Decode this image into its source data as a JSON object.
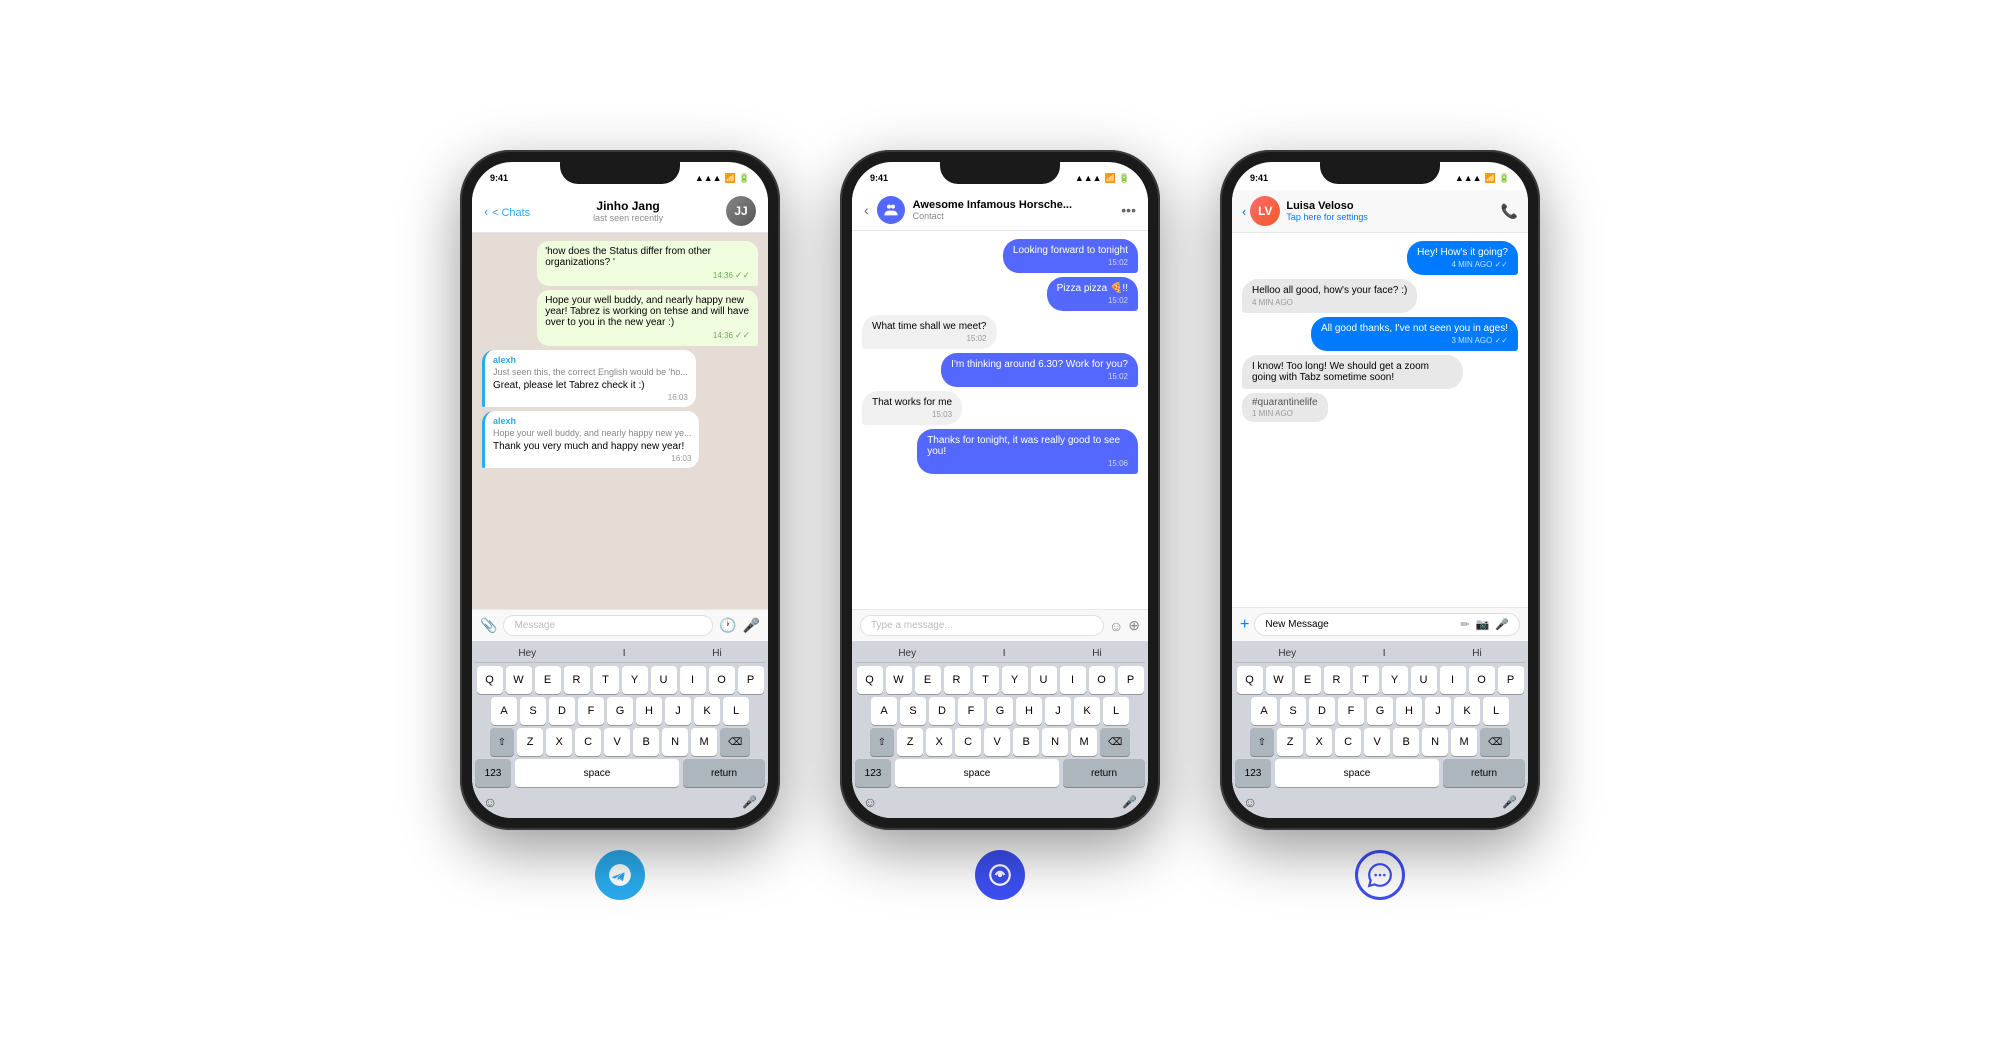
{
  "phone1": {
    "statusBar": {
      "time": "9:41",
      "signal": "▲▲▲",
      "wifi": "wifi",
      "battery": "battery"
    },
    "header": {
      "backLabel": "< Chats",
      "contactName": "Jinho Jang",
      "contactStatus": "last seen recently",
      "avatarInitial": "JJ"
    },
    "messages": [
      {
        "type": "outgoing",
        "text": "'how does the Status differ from other organizations? '",
        "time": "14:36",
        "checked": true
      },
      {
        "type": "outgoing",
        "text": "Hope your well buddy, and nearly happy new year! Tabrez is working on tehse and will have over to you in the new year :)",
        "time": "14:36",
        "checked": true
      },
      {
        "type": "reply",
        "author": "alexh",
        "replyText": "Just seen this, the correct English would be 'ho...",
        "text": "Great, please let Tabrez check it :)",
        "time": "16:03"
      },
      {
        "type": "reply",
        "author": "alexh",
        "replyText": "Hope your well buddy, and nearly happy new ye...",
        "text": "Thank you very much and happy new year!",
        "time": "16:03"
      }
    ],
    "inputPlaceholder": "Message",
    "keyboard": {
      "suggestions": [
        "Hey",
        "I",
        "Hi"
      ],
      "rows": [
        [
          "Q",
          "W",
          "E",
          "R",
          "T",
          "Y",
          "U",
          "I",
          "O",
          "P"
        ],
        [
          "A",
          "S",
          "D",
          "F",
          "G",
          "H",
          "J",
          "K",
          "L"
        ],
        [
          "Z",
          "X",
          "C",
          "V",
          "B",
          "N",
          "M"
        ]
      ],
      "keys123": "123",
      "spaceLabel": "space",
      "returnLabel": "return"
    },
    "appIcon": "telegram"
  },
  "phone2": {
    "statusBar": {
      "time": "9:41"
    },
    "header": {
      "contactName": "Awesome Infamous Horsche...",
      "contactSub": "Contact"
    },
    "messages": [
      {
        "type": "outgoing",
        "text": "Looking forward to tonight",
        "time": "15:02"
      },
      {
        "type": "outgoing",
        "text": "Pizza pizza 🍕!! ",
        "time": "15:02"
      },
      {
        "type": "incoming",
        "text": "What time shall we meet?",
        "time": "15:02"
      },
      {
        "type": "outgoing",
        "text": "I'm thinking around 6.30? Work for you?",
        "time": "15:02"
      },
      {
        "type": "incoming",
        "text": "That works for me",
        "time": "15:03"
      },
      {
        "type": "outgoing",
        "text": "Thanks for tonight, it was really good to see you!",
        "time": "15:06"
      }
    ],
    "inputPlaceholder": "Type a message...",
    "keyboard": {
      "suggestions": [
        "Hey",
        "I",
        "Hi"
      ],
      "rows": [
        [
          "Q",
          "W",
          "E",
          "R",
          "T",
          "Y",
          "U",
          "I",
          "O",
          "P"
        ],
        [
          "A",
          "S",
          "D",
          "F",
          "G",
          "H",
          "J",
          "K",
          "L"
        ],
        [
          "Z",
          "X",
          "C",
          "V",
          "B",
          "N",
          "M"
        ]
      ],
      "keys123": "123",
      "spaceLabel": "space",
      "returnLabel": "return"
    },
    "appIcon": "bridge"
  },
  "phone3": {
    "statusBar": {
      "time": "9:41"
    },
    "header": {
      "contactName": "Luisa Veloso",
      "contactSub": "Tap here for settings",
      "avatarInitial": "LV"
    },
    "messages": [
      {
        "type": "outgoing",
        "text": "Hey! How's it going?",
        "time": "4 MIN AGO",
        "checked": true
      },
      {
        "type": "incoming",
        "text": "Helloo all good, how's your face? :)",
        "time": "4 MIN AGO"
      },
      {
        "type": "outgoing",
        "text": "All good thanks, I've not seen you in ages!",
        "time": "3 MIN AGO",
        "checked": true
      },
      {
        "type": "incoming",
        "text": "I know! Too long! We should get a zoom going with Tabz sometime soon!",
        "time": ""
      },
      {
        "type": "hashtag",
        "text": "#quarantinelife",
        "time": "1 MIN AGO"
      }
    ],
    "inputPlaceholder": "New Message",
    "keyboard": {
      "suggestions": [
        "Hey",
        "I",
        "Hi"
      ],
      "rows": [
        [
          "Q",
          "W",
          "E",
          "R",
          "T",
          "Y",
          "U",
          "I",
          "O",
          "P"
        ],
        [
          "A",
          "S",
          "D",
          "F",
          "G",
          "H",
          "J",
          "K",
          "L"
        ],
        [
          "Z",
          "X",
          "C",
          "V",
          "B",
          "N",
          "M"
        ]
      ],
      "keys123": "123",
      "spaceLabel": "space",
      "returnLabel": "return"
    },
    "appIcon": "signal"
  }
}
